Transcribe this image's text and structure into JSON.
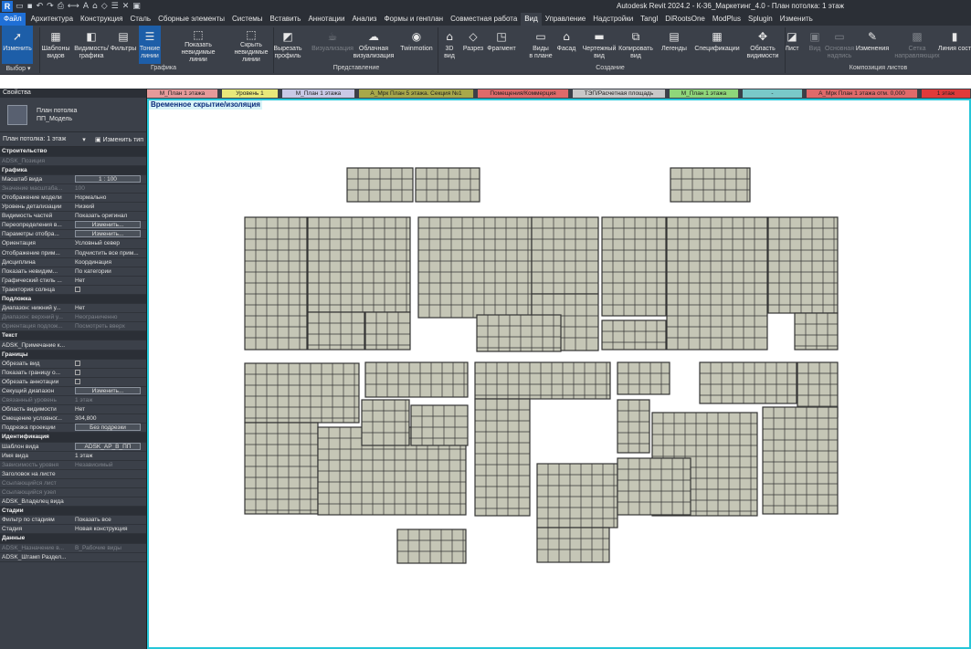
{
  "app": {
    "logo": "R",
    "title": "Autodesk Revit 2024.2 - К-36_Маркетинг_4.0 - План потолка: 1 этаж",
    "qat_icons": [
      "open-icon",
      "save-icon",
      "undo-icon",
      "redo-icon",
      "print-icon",
      "measure-icon",
      "text-icon",
      "3d-icon",
      "section-icon",
      "thin-lines-icon",
      "close-inactive-icon",
      "switch-windows-icon"
    ]
  },
  "menu": [
    "Файл",
    "Архитектура",
    "Конструкция",
    "Сталь",
    "Сборные элементы",
    "Системы",
    "Вставить",
    "Аннотации",
    "Анализ",
    "Формы и генплан",
    "Совместная работа",
    "Вид",
    "Управление",
    "Надстройки",
    "Tangl",
    "DiRootsOne",
    "ModPlus",
    "Splugin",
    "Изменить"
  ],
  "ribbon": {
    "buttons": [
      {
        "label": "Изменить",
        "icon": "cursor-icon",
        "glyph": "➚",
        "sel": true
      },
      {
        "label": "Шаблоны\nвидов",
        "icon": "view-templates-icon",
        "glyph": "▦"
      },
      {
        "label": "Видимость/\nграфика",
        "icon": "visibility-icon",
        "glyph": "◧"
      },
      {
        "label": "Фильтры",
        "icon": "filters-icon",
        "glyph": "▤"
      },
      {
        "label": "Тонкие\nлинии",
        "icon": "thin-lines-icon",
        "glyph": "☰",
        "sel": true
      },
      {
        "label": "Показать\nневидимые линии",
        "icon": "show-hidden-lines-icon",
        "glyph": "⬚"
      },
      {
        "label": "Скрыть\nневидимые линии",
        "icon": "remove-hidden-lines-icon",
        "glyph": "⬚"
      },
      {
        "label": "Вырезать\nпрофиль",
        "icon": "cut-profile-icon",
        "glyph": "◩"
      },
      {
        "label": "Визуализация",
        "icon": "render-icon",
        "glyph": "☕",
        "dis": true
      },
      {
        "label": "Облачная\nвизуализация",
        "icon": "cloud-render-icon",
        "glyph": "☁"
      },
      {
        "label": "Twinmotion",
        "icon": "twinmotion-icon",
        "glyph": "◉"
      },
      {
        "label": "3D\nвид",
        "icon": "3d-view-icon",
        "glyph": "⌂"
      },
      {
        "label": "Разрез",
        "icon": "section-icon",
        "glyph": "◇"
      },
      {
        "label": "Фрагмент",
        "icon": "callout-icon",
        "glyph": "◳"
      },
      {
        "label": "Виды\nв плане",
        "icon": "plan-views-icon",
        "glyph": "▭"
      },
      {
        "label": "Фасад",
        "icon": "elevation-icon",
        "glyph": "⌂"
      },
      {
        "label": "Чертежный\nвид",
        "icon": "drafting-view-icon",
        "glyph": "▬"
      },
      {
        "label": "Копировать\nвид",
        "icon": "duplicate-view-icon",
        "glyph": "⧉"
      },
      {
        "label": "Легенды",
        "icon": "legends-icon",
        "glyph": "▤"
      },
      {
        "label": "Спецификации",
        "icon": "schedules-icon",
        "glyph": "▦"
      },
      {
        "label": "Область\nвидимости",
        "icon": "scope-box-icon",
        "glyph": "✥"
      },
      {
        "label": "Лист",
        "icon": "sheet-icon",
        "glyph": "◪"
      },
      {
        "label": "Вид",
        "icon": "view-place-icon",
        "glyph": "▣",
        "dis": true
      },
      {
        "label": "Основная\nнадпись",
        "icon": "title-block-icon",
        "glyph": "▭",
        "dis": true
      },
      {
        "label": "Изменения",
        "icon": "revisions-icon",
        "glyph": "✎"
      },
      {
        "label": "Сетка\nнаправляющих",
        "icon": "guide-grid-icon",
        "glyph": "▩",
        "dis": true
      },
      {
        "label": "Линия сост",
        "icon": "matchline-icon",
        "glyph": "▮"
      }
    ],
    "panels": [
      "Выбор ▾",
      "Графика",
      "Представление",
      "Создание",
      "Композиция листов"
    ]
  },
  "properties": {
    "title": "Свойства",
    "type_name": "План потолка",
    "type_sub": "ПП_Модель",
    "instance": "План потолка: 1 этаж",
    "edit_type": "Изменить тип",
    "rows": [
      {
        "g": "Строительство"
      },
      {
        "k": "ADSK_Позиция",
        "v": "",
        "dim": true
      },
      {
        "g": "Графика"
      },
      {
        "k": "Масштаб вида",
        "v": "1 : 100",
        "box": true
      },
      {
        "k": "Значение масштаба...",
        "v": "100",
        "dim": true
      },
      {
        "k": "Отображение модели",
        "v": "Нормально"
      },
      {
        "k": "Уровень детализации",
        "v": "Низкий"
      },
      {
        "k": "Видимость частей",
        "v": "Показать оригинал"
      },
      {
        "k": "Переопределения в...",
        "v": "Изменить...",
        "btn": true
      },
      {
        "k": "Параметры отобра...",
        "v": "Изменить...",
        "btn": true
      },
      {
        "k": "Ориентация",
        "v": "Условный север"
      },
      {
        "k": "Отображение прим...",
        "v": "Подчистить все прим..."
      },
      {
        "k": "Дисциплина",
        "v": "Координация"
      },
      {
        "k": "Показать невидим...",
        "v": "По категории"
      },
      {
        "k": "Графический стиль ...",
        "v": "Нет"
      },
      {
        "k": "Траектория солнца",
        "v": "",
        "cb": true
      },
      {
        "g": "Подложка"
      },
      {
        "k": "Диапазон: нижний у...",
        "v": "Нет"
      },
      {
        "k": "Диапазон: верхний у...",
        "v": "Неограниченно",
        "dim": true
      },
      {
        "k": "Ориентация подлож...",
        "v": "Посмотреть вверх",
        "dim": true
      },
      {
        "g": "Текст"
      },
      {
        "k": "ADSK_Примечание к...",
        "v": ""
      },
      {
        "g": "Границы"
      },
      {
        "k": "Обрезать вид",
        "v": "",
        "cb": true
      },
      {
        "k": "Показать границу о...",
        "v": "",
        "cb": true
      },
      {
        "k": "Обрезать аннотации",
        "v": "",
        "cb": true
      },
      {
        "k": "Секущий диапазон",
        "v": "Изменить...",
        "btn": true
      },
      {
        "k": "Связанный уровень",
        "v": "1 этаж",
        "dim": true
      },
      {
        "k": "Область видимости",
        "v": "Нет"
      },
      {
        "k": "Смещение условног...",
        "v": "304,800"
      },
      {
        "k": "Подрезка проекции",
        "v": "Без подрезки",
        "btn": true
      },
      {
        "g": "Идентификация"
      },
      {
        "k": "Шаблон вида",
        "v": "ADSK_АР_В_ПП",
        "btn": true
      },
      {
        "k": "Имя вида",
        "v": "1 этаж"
      },
      {
        "k": "Зависимость уровня",
        "v": "Независимый",
        "dim": true
      },
      {
        "k": "Заголовок на листе",
        "v": ""
      },
      {
        "k": "Ссылающийся лист",
        "v": "",
        "dim": true
      },
      {
        "k": "Ссылающийся узел",
        "v": "",
        "dim": true
      },
      {
        "k": "ADSK_Владелец вида",
        "v": ""
      },
      {
        "g": "Стадии"
      },
      {
        "k": "Фильтр по стадиям",
        "v": "Показать все"
      },
      {
        "k": "Стадия",
        "v": "Новая конструкция"
      },
      {
        "g": "Данные"
      },
      {
        "k": "ADSK_Назначение в...",
        "v": "В_Рабочие виды",
        "dim": true
      },
      {
        "k": "ADSK_Штамп Раздел...",
        "v": ""
      }
    ]
  },
  "view_tabs": [
    {
      "label": "М_План 1 этажа",
      "color": "#e59a9a"
    },
    {
      "label": "Уровень 1",
      "color": "#e8e87a"
    },
    {
      "label": "М_План 1 этажа",
      "color": "#c9c9e6"
    },
    {
      "label": "А_Мрк План 5 этажа. Секция №1",
      "color": "#a8a84a"
    },
    {
      "label": "Помещения/Коммерция",
      "color": "#e06a6a"
    },
    {
      "label": "ТЭП/Расчетная площадь",
      "color": "#c8c8c8"
    },
    {
      "label": "М_План 1 этажа",
      "color": "#8fd67a"
    },
    {
      "label": "-",
      "color": "#7ac9c9"
    },
    {
      "label": "А_Мрк План 1 этажа отм. 0,000",
      "color": "#e06a6a"
    },
    {
      "label": "1 этаж",
      "color": "#e03a3a"
    }
  ],
  "canvas": {
    "temp_hide": "Временное скрытие/изоляция",
    "tile_color": "#c5c6b6",
    "grid_color": "#333333"
  }
}
